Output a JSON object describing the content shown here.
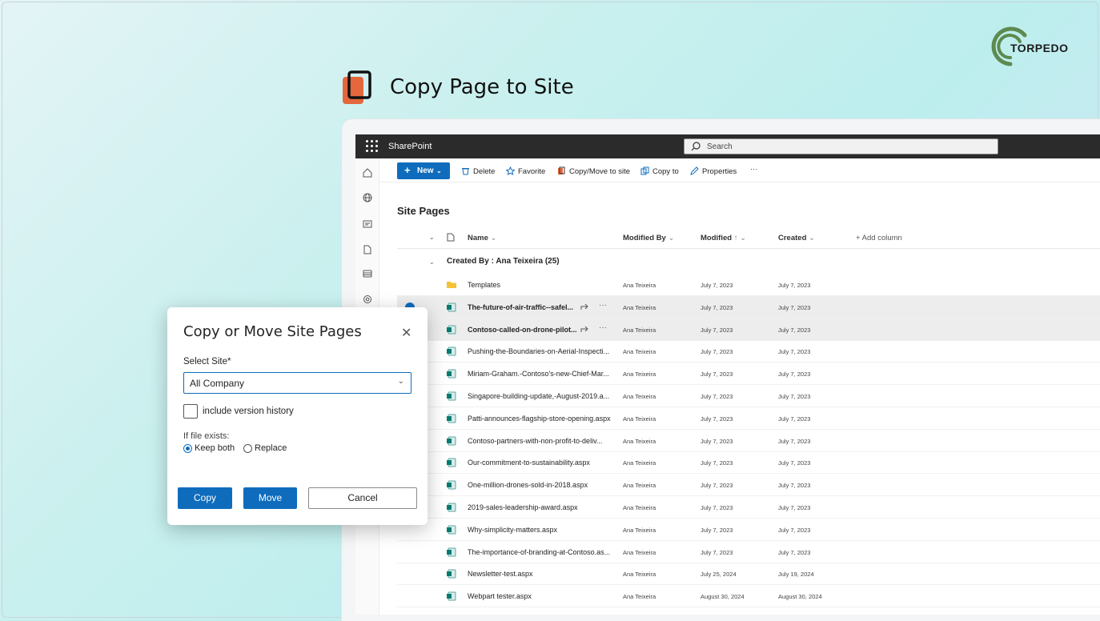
{
  "brand": {
    "logo_text": "TORPEDO"
  },
  "headline": "Copy Page to Site",
  "sharepoint": {
    "app_name": "SharePoint",
    "search_placeholder": "Search",
    "commands": {
      "new": "New",
      "delete": "Delete",
      "favorite": "Favorite",
      "copy_move": "Copy/Move to site",
      "copy_to": "Copy to",
      "properties": "Properties",
      "more": "···"
    },
    "library_title": "Site Pages",
    "columns": {
      "name": "Name",
      "modified_by": "Modified By",
      "modified": "Modified",
      "created": "Created",
      "add_column": "+ Add column"
    },
    "group_label": "Created By : Ana Teixeira (25)",
    "rows": [
      {
        "name": "Templates",
        "type": "folder",
        "by": "Ana Teixeira",
        "modified": "July 7, 2023",
        "created": "July 7, 2023",
        "selected": false
      },
      {
        "name": "The-future-of-air-traffic--safel...",
        "type": "page",
        "by": "Ana Teixeira",
        "modified": "July 7, 2023",
        "created": "July 7, 2023",
        "selected": true
      },
      {
        "name": "Contoso-called-on-drone-pilot...",
        "type": "page",
        "by": "Ana Teixeira",
        "modified": "July 7, 2023",
        "created": "July 7, 2023",
        "selected": true
      },
      {
        "name": "Pushing-the-Boundaries-on-Aerial-Inspecti...",
        "type": "page",
        "by": "Ana Teixeira",
        "modified": "July 7, 2023",
        "created": "July 7, 2023",
        "selected": false
      },
      {
        "name": "Miriam-Graham.-Contoso's-new-Chief-Mar...",
        "type": "page",
        "by": "Ana Teixeira",
        "modified": "July 7, 2023",
        "created": "July 7, 2023",
        "selected": false
      },
      {
        "name": "Singapore-building-update,-August-2019.a...",
        "type": "page",
        "by": "Ana Teixeira",
        "modified": "July 7, 2023",
        "created": "July 7, 2023",
        "selected": false
      },
      {
        "name": "Patti-announces-flagship-store-opening.aspx",
        "type": "page",
        "by": "Ana Teixeira",
        "modified": "July 7, 2023",
        "created": "July 7, 2023",
        "selected": false
      },
      {
        "name": "Contoso-partners-with-non-profit-to-deliv...",
        "type": "page",
        "by": "Ana Teixeira",
        "modified": "July 7, 2023",
        "created": "July 7, 2023",
        "selected": false
      },
      {
        "name": "Our-commitment-to-sustainability.aspx",
        "type": "page",
        "by": "Ana Teixeira",
        "modified": "July 7, 2023",
        "created": "July 7, 2023",
        "selected": false
      },
      {
        "name": "One-million-drones-sold-in-2018.aspx",
        "type": "page",
        "by": "Ana Teixeira",
        "modified": "July 7, 2023",
        "created": "July 7, 2023",
        "selected": false
      },
      {
        "name": "2019-sales-leadership-award.aspx",
        "type": "page",
        "by": "Ana Teixeira",
        "modified": "July 7, 2023",
        "created": "July 7, 2023",
        "selected": false
      },
      {
        "name": "Why-simplicity-matters.aspx",
        "type": "page",
        "by": "Ana Teixeira",
        "modified": "July 7, 2023",
        "created": "July 7, 2023",
        "selected": false
      },
      {
        "name": "The-importance-of-branding-at-Contoso.as...",
        "type": "page",
        "by": "Ana Teixeira",
        "modified": "July 7, 2023",
        "created": "July 7, 2023",
        "selected": false
      },
      {
        "name": "Newsletter-test.aspx",
        "type": "page",
        "by": "Ana Teixeira",
        "modified": "July 25, 2024",
        "created": "July 19, 2024",
        "selected": false
      },
      {
        "name": "Webpart tester.aspx",
        "type": "page",
        "by": "Ana Teixeira",
        "modified": "August 30, 2024",
        "created": "August 30, 2024",
        "selected": false
      }
    ]
  },
  "dialog": {
    "title": "Copy or Move Site Pages",
    "select_label": "Select Site*",
    "select_value": "All Company",
    "version_history_label": "include version history",
    "version_history_checked": false,
    "file_exists_label": "If file exists:",
    "options": [
      "Keep both",
      "Replace"
    ],
    "selected_option": "Keep both",
    "buttons": {
      "copy": "Copy",
      "move": "Move",
      "cancel": "Cancel"
    }
  },
  "colors": {
    "accent": "#0f6cbd",
    "suite_bar": "#2b2b2b",
    "headline_icon": "#e5673d",
    "logo": "#5e8a4f"
  }
}
